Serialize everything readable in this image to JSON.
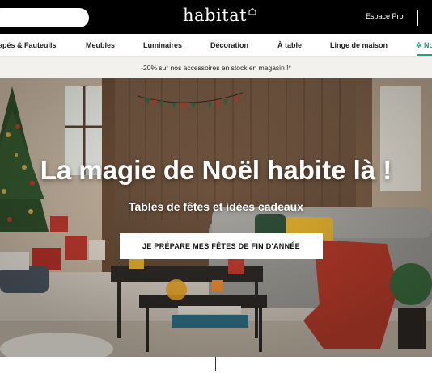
{
  "header": {
    "search": {
      "placeholder": ""
    },
    "logo_text": "habitat",
    "espace_pro": "Espace Pro"
  },
  "nav": {
    "items": [
      {
        "label": "apés & Fauteuils"
      },
      {
        "label": "Meubles"
      },
      {
        "label": "Luminaires"
      },
      {
        "label": "Décoration"
      },
      {
        "label": "À table"
      },
      {
        "label": "Linge de maison"
      },
      {
        "label": "✲ No"
      }
    ]
  },
  "promo": {
    "text": "-20% sur nos accessoires en stock en magasin !*"
  },
  "hero": {
    "title": "La magie de Noël habite là !",
    "subtitle": "Tables de fêtes et idées cadeaux",
    "cta_label": "JE PRÉPARE MES FÊTES DE FIN D'ANNÉE"
  },
  "colors": {
    "topbar": "#000000",
    "accent_green": "#2a9d7a",
    "promo_bg": "#f3f1ee",
    "sofa_grey": "#9a9893",
    "throw_red": "#b53a2a",
    "cushion_yellow": "#e3b12e"
  },
  "icons": {
    "logo_mark": "house-icon"
  }
}
